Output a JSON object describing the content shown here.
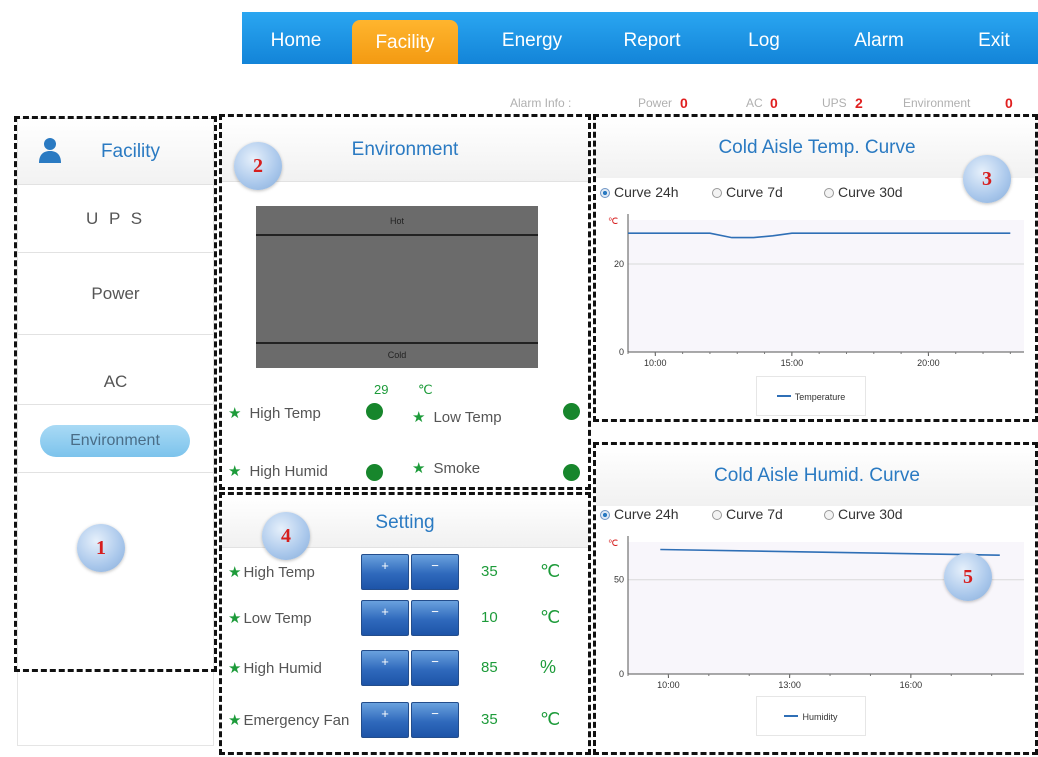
{
  "nav": {
    "items": [
      {
        "label": "Home",
        "active": false
      },
      {
        "label": "Facility",
        "active": true
      },
      {
        "label": "Energy",
        "active": false
      },
      {
        "label": "Report",
        "active": false
      },
      {
        "label": "Log",
        "active": false
      },
      {
        "label": "Alarm",
        "active": false
      },
      {
        "label": "Exit",
        "active": false
      }
    ],
    "colors": {
      "bar": "#1b93e4",
      "active": "#f7a51f"
    }
  },
  "alarm_info": {
    "label": "Alarm Info :",
    "items": [
      {
        "label": "Power",
        "value": "0"
      },
      {
        "label": "AC",
        "value": "0"
      },
      {
        "label": "UPS",
        "value": "2"
      },
      {
        "label": "Environment",
        "value": "0"
      }
    ]
  },
  "sidebar": {
    "title": "Facility",
    "title_icon": "user-icon",
    "items": [
      {
        "label": "U P S",
        "selected": false
      },
      {
        "label": "Power",
        "selected": false
      },
      {
        "label": "AC",
        "selected": false
      },
      {
        "label": "Environment",
        "selected": true
      }
    ]
  },
  "badges": [
    "1",
    "2",
    "3",
    "4",
    "5"
  ],
  "environment": {
    "title": "Environment",
    "box": {
      "top_label": "Hot",
      "bottom_label": "Cold"
    },
    "temp_value": "29",
    "temp_unit": "℃",
    "indicators": [
      {
        "label": "High Temp",
        "status_color": "#17862c"
      },
      {
        "label": "Low Temp",
        "status_color": "#17862c"
      },
      {
        "label": "High Humid",
        "status_color": "#17862c"
      },
      {
        "label": "Smoke",
        "status_color": "#17862c"
      }
    ],
    "star": "★"
  },
  "setting": {
    "title": "Setting",
    "plus": "+",
    "minus": "−",
    "rows": [
      {
        "label": "High Temp",
        "value": "35",
        "unit": "℃"
      },
      {
        "label": "Low Temp",
        "value": "10",
        "unit": "℃"
      },
      {
        "label": "High Humid",
        "value": "85",
        "unit": "%"
      },
      {
        "label": "Emergency Fan",
        "value": "35",
        "unit": "℃"
      }
    ]
  },
  "temp_chart": {
    "title": "Cold Aisle Temp. Curve",
    "options": [
      {
        "label": "Curve 24h",
        "selected": true
      },
      {
        "label": "Curve 7d",
        "selected": false
      },
      {
        "label": "Curve 30d",
        "selected": false
      }
    ]
  },
  "humid_chart": {
    "title": "Cold Aisle Humid. Curve",
    "options": [
      {
        "label": "Curve 24h",
        "selected": true
      },
      {
        "label": "Curve 7d",
        "selected": false
      },
      {
        "label": "Curve 30d",
        "selected": false
      }
    ]
  },
  "chart_data": [
    {
      "type": "line",
      "title": "Cold Aisle Temp. Curve",
      "ylabel": "℃",
      "x_ticks": [
        "10:00",
        "15:00",
        "20:00"
      ],
      "y_ticks": [
        0,
        20
      ],
      "ylim": [
        0,
        30
      ],
      "grid": true,
      "legend": "bottom",
      "series": [
        {
          "name": "Temperature",
          "color": "#2f6fb6",
          "x": [
            9.0,
            12.0,
            12.8,
            13.6,
            14.3,
            15.0,
            16.0,
            20.0,
            23.0
          ],
          "y": [
            27,
            27,
            26,
            26,
            26.4,
            27,
            27,
            27,
            27
          ]
        }
      ]
    },
    {
      "type": "line",
      "title": "Cold Aisle Humid. Curve",
      "ylabel": "℃",
      "x_ticks": [
        "10:00",
        "13:00",
        "16:00"
      ],
      "y_ticks": [
        0,
        50
      ],
      "ylim": [
        0,
        70
      ],
      "grid": true,
      "legend": "bottom",
      "series": [
        {
          "name": "Humidity",
          "color": "#2f6fb6",
          "x": [
            9.8,
            18.2
          ],
          "y": [
            66,
            63
          ]
        }
      ]
    }
  ]
}
